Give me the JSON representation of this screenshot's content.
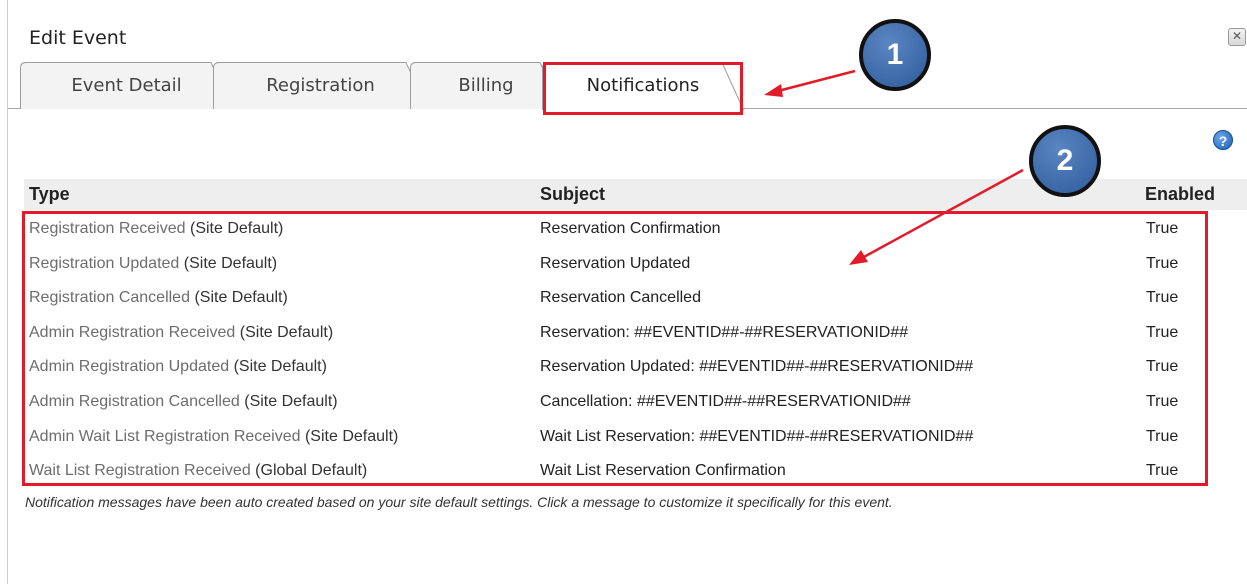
{
  "dialog": {
    "title": "Edit Event",
    "close_icon": "close-icon"
  },
  "tabs": [
    {
      "label": "Event Detail",
      "active": false
    },
    {
      "label": "Registration",
      "active": false
    },
    {
      "label": "Billing",
      "active": false
    },
    {
      "label": "Notifications",
      "active": true
    }
  ],
  "help": {
    "icon": "help-icon",
    "glyph": "?"
  },
  "table": {
    "columns": [
      "Type",
      "Subject",
      "Enabled"
    ],
    "rows": [
      {
        "type": "Registration Received",
        "source": "(Site Default)",
        "subject": "Reservation Confirmation",
        "enabled": "True"
      },
      {
        "type": "Registration Updated",
        "source": "(Site Default)",
        "subject": "Reservation Updated",
        "enabled": "True"
      },
      {
        "type": "Registration Cancelled",
        "source": "(Site Default)",
        "subject": "Reservation Cancelled",
        "enabled": "True"
      },
      {
        "type": "Admin Registration Received",
        "source": "(Site Default)",
        "subject": "Reservation: ##EVENTID##-##RESERVATIONID##",
        "enabled": "True"
      },
      {
        "type": "Admin Registration Updated",
        "source": "(Site Default)",
        "subject": "Reservation Updated: ##EVENTID##-##RESERVATIONID##",
        "enabled": "True"
      },
      {
        "type": "Admin Registration Cancelled",
        "source": "(Site Default)",
        "subject": "Cancellation: ##EVENTID##-##RESERVATIONID##",
        "enabled": "True"
      },
      {
        "type": "Admin Wait List Registration Received",
        "source": "(Site Default)",
        "subject": "Wait List Reservation: ##EVENTID##-##RESERVATIONID##",
        "enabled": "True"
      },
      {
        "type": "Wait List Registration Received",
        "source": "(Global Default)",
        "subject": "Wait List Reservation Confirmation",
        "enabled": "True"
      }
    ]
  },
  "footnote": "Notification messages have been auto created based on your site default settings. Click a message to customize it specifically for this event.",
  "annotations": {
    "step1": "1",
    "step2": "2",
    "color": "#e21b2a"
  }
}
